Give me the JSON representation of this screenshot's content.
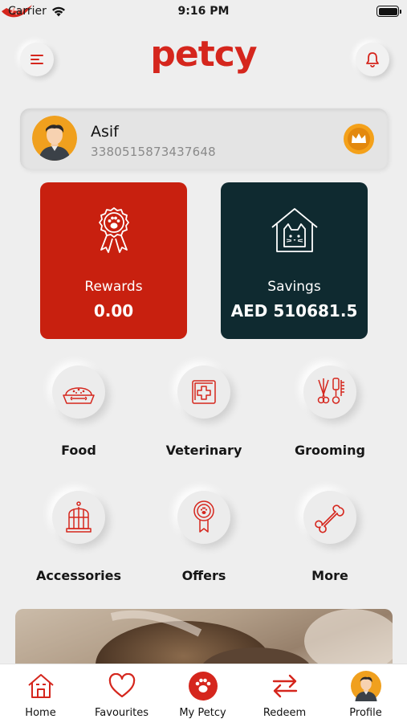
{
  "status_bar": {
    "carrier": "Carrier",
    "time": "9:16 PM"
  },
  "header": {
    "logo_text": "petcy",
    "menu_icon": "menu-icon",
    "notification_icon": "bell-icon"
  },
  "profile": {
    "name": "Asif",
    "member_id": "3380515873437648",
    "badge_icon": "crown-icon"
  },
  "stats": {
    "rewards": {
      "label": "Rewards",
      "value": "0.00",
      "icon": "paw-ribbon-icon"
    },
    "savings": {
      "label": "Savings",
      "value": "AED 510681.5",
      "icon": "cat-house-icon"
    }
  },
  "categories": [
    {
      "label": "Food",
      "icon": "food-bowl-icon"
    },
    {
      "label": "Veterinary",
      "icon": "first-aid-icon"
    },
    {
      "label": "Grooming",
      "icon": "grooming-tools-icon"
    },
    {
      "label": "Accessories",
      "icon": "bird-cage-icon"
    },
    {
      "label": "Offers",
      "icon": "offer-badge-icon"
    },
    {
      "label": "More",
      "icon": "bone-icon"
    }
  ],
  "bottom_nav": [
    {
      "label": "Home",
      "icon": "home-icon"
    },
    {
      "label": "Favourites",
      "icon": "heart-icon"
    },
    {
      "label": "My Petcy",
      "icon": "paw-icon"
    },
    {
      "label": "Redeem",
      "icon": "swap-arrows-icon"
    },
    {
      "label": "Profile",
      "icon": "avatar-icon"
    }
  ],
  "colors": {
    "brand_red": "#c8200f",
    "dark_teal": "#0f2a30",
    "background": "#eeeeee",
    "muted_text": "#8a8a8a"
  }
}
